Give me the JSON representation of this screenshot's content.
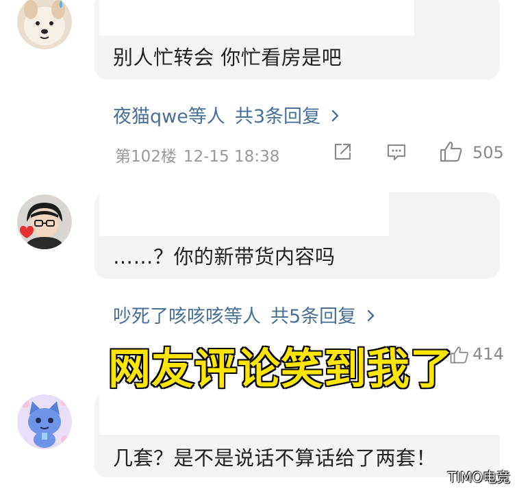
{
  "comments": [
    {
      "text": "别人忙转会 你忙看房是吧",
      "reply_users": "夜猫qwe等人",
      "reply_count": "共3条回复",
      "floor": "第102楼",
      "timestamp": "12-15 18:38",
      "likes": "505"
    },
    {
      "text": "……？你的新带货内容吗",
      "reply_users": "吵死了咳咳咳等人",
      "reply_count": "共5条回复",
      "likes": "414"
    },
    {
      "text": "几套？是不是说话不算话给了两套！"
    }
  ],
  "overlay_caption": "网友评论笑到我了",
  "watermark": "TIMO电竞",
  "icons": {
    "share": "share-icon",
    "reply": "comment-icon",
    "like": "thumbs-up-icon",
    "chevron": "chevron-right-icon"
  },
  "colors": {
    "link": "#4a6f96",
    "caption_fill": "#ffe600",
    "bubble": "#f4f4f5"
  }
}
